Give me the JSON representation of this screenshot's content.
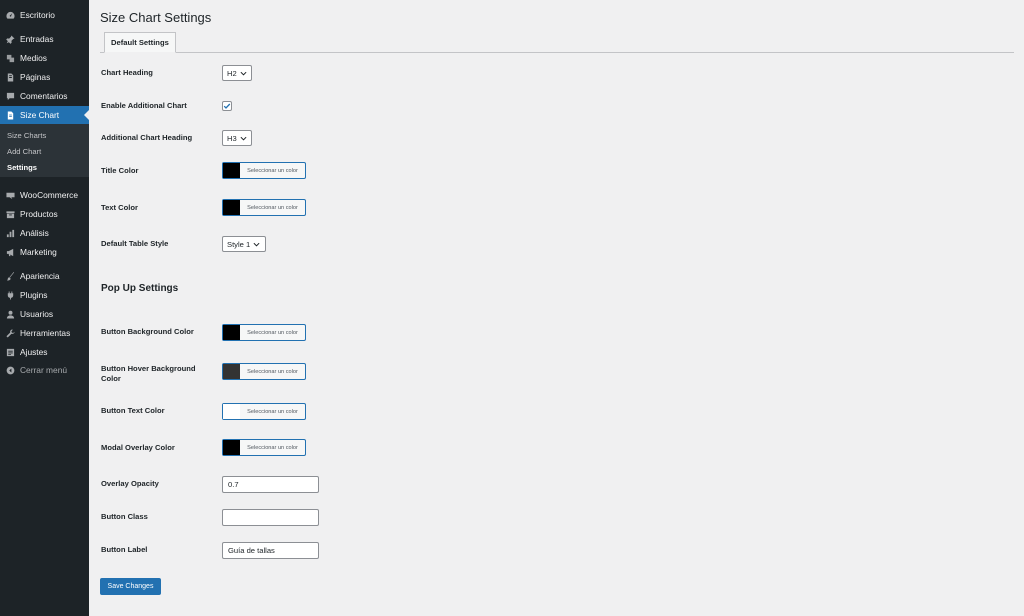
{
  "sidebar": {
    "items": [
      {
        "label": "Escritorio",
        "icon": "dashboard-icon"
      },
      {
        "label": "Entradas",
        "icon": "pin-icon"
      },
      {
        "label": "Medios",
        "icon": "media-icon"
      },
      {
        "label": "Páginas",
        "icon": "pages-icon"
      },
      {
        "label": "Comentarios",
        "icon": "comments-icon"
      },
      {
        "label": "Size Chart",
        "icon": "document-icon"
      },
      {
        "label": "WooCommerce",
        "icon": "woocommerce-icon"
      },
      {
        "label": "Productos",
        "icon": "archive-icon"
      },
      {
        "label": "Análisis",
        "icon": "bar-chart-icon"
      },
      {
        "label": "Marketing",
        "icon": "megaphone-icon"
      },
      {
        "label": "Apariencia",
        "icon": "brush-icon"
      },
      {
        "label": "Plugins",
        "icon": "plugin-icon"
      },
      {
        "label": "Usuarios",
        "icon": "user-icon"
      },
      {
        "label": "Herramientas",
        "icon": "wrench-icon"
      },
      {
        "label": "Ajustes",
        "icon": "settings-icon"
      },
      {
        "label": "Cerrar menú",
        "icon": "collapse-icon"
      }
    ],
    "submenu": [
      "Size Charts",
      "Add Chart",
      "Settings"
    ]
  },
  "page": {
    "title": "Size Chart Settings",
    "tab": "Default Settings",
    "color_button_text": "Seleccionar un color",
    "save_label": "Save Changes"
  },
  "settings": {
    "chart_heading": {
      "label": "Chart Heading",
      "value": "H2"
    },
    "enable_additional": {
      "label": "Enable Additional Chart",
      "checked": true
    },
    "additional_heading": {
      "label": "Additional Chart Heading",
      "value": "H3"
    },
    "title_color": {
      "label": "Title Color",
      "color": "#000000"
    },
    "text_color": {
      "label": "Text Color",
      "color": "#000000"
    },
    "table_style": {
      "label": "Default Table Style",
      "value": "Style 1"
    }
  },
  "popup": {
    "section_title": "Pop Up Settings",
    "button_bg": {
      "label": "Button Background Color",
      "color": "#000000"
    },
    "button_hover_bg": {
      "label_line1": "Button Hover Background",
      "label_line2": "Color",
      "color": "#333333"
    },
    "button_text": {
      "label": "Button Text Color",
      "color": "#ffffff"
    },
    "modal_overlay": {
      "label": "Modal Overlay Color",
      "color": "#000000"
    },
    "overlay_opacity": {
      "label": "Overlay Opacity",
      "value": "0.7"
    },
    "button_class": {
      "label": "Button Class",
      "value": ""
    },
    "button_label": {
      "label": "Button Label",
      "value": "Guía de tallas"
    }
  },
  "colors": {
    "sidebar_bg": "#1d2327",
    "accent": "#2271b1",
    "page_bg": "#f0f0f1"
  }
}
